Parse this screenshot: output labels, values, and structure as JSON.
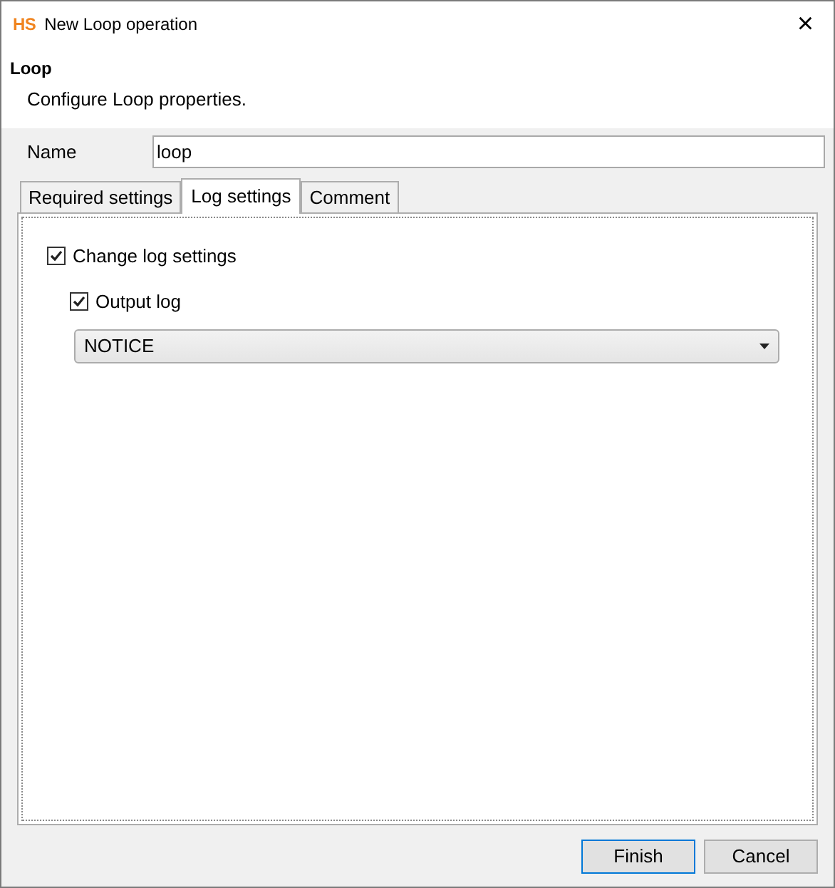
{
  "window": {
    "logo": "HS",
    "title": "New Loop operation",
    "close": "×"
  },
  "header": {
    "title": "Loop",
    "description": "Configure Loop properties."
  },
  "name_field": {
    "label": "Name",
    "value": "loop"
  },
  "tabs": [
    {
      "label": "Required settings",
      "selected": false
    },
    {
      "label": "Log settings",
      "selected": true
    },
    {
      "label": "Comment",
      "selected": false
    }
  ],
  "options": [
    {
      "label": "Change log settings",
      "checked": true,
      "children": [
        {
          "label": "Output log",
          "checked": true
        }
      ]
    }
  ],
  "log_level": {
    "value": "NOTICE"
  },
  "buttons": [
    {
      "label": "Finish",
      "default": true
    },
    {
      "label": "Cancel",
      "default": false
    }
  ]
}
